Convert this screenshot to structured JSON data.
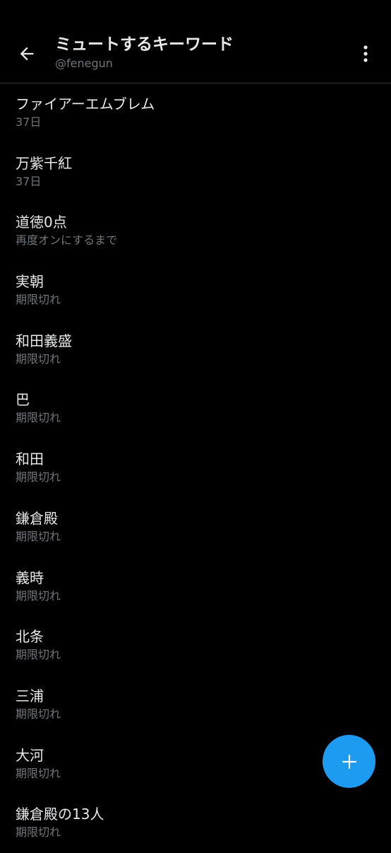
{
  "header": {
    "title": "ミュートするキーワード",
    "subtitle": "@fenegun",
    "back_icon": "arrow-left-icon",
    "more_icon": "more-vertical-icon"
  },
  "muted_words": [
    {
      "word": "ファイアーエムブレム",
      "status": "37日"
    },
    {
      "word": "万紫千紅",
      "status": "37日"
    },
    {
      "word": "道徳0点",
      "status": "再度オンにするまで"
    },
    {
      "word": "実朝",
      "status": "期限切れ"
    },
    {
      "word": "和田義盛",
      "status": "期限切れ"
    },
    {
      "word": "巴",
      "status": "期限切れ"
    },
    {
      "word": "和田",
      "status": "期限切れ"
    },
    {
      "word": "鎌倉殿",
      "status": "期限切れ"
    },
    {
      "word": "義時",
      "status": "期限切れ"
    },
    {
      "word": "北条",
      "status": "期限切れ"
    },
    {
      "word": "三浦",
      "status": "期限切れ"
    },
    {
      "word": "大河",
      "status": "期限切れ"
    },
    {
      "word": "鎌倉殿の13人",
      "status": "期限切れ"
    }
  ],
  "fab": {
    "icon": "plus-icon"
  },
  "colors": {
    "background": "#000000",
    "text_primary": "#e7e9ea",
    "text_secondary": "#71767b",
    "accent": "#1d9bf0",
    "divider": "#2f3336"
  }
}
